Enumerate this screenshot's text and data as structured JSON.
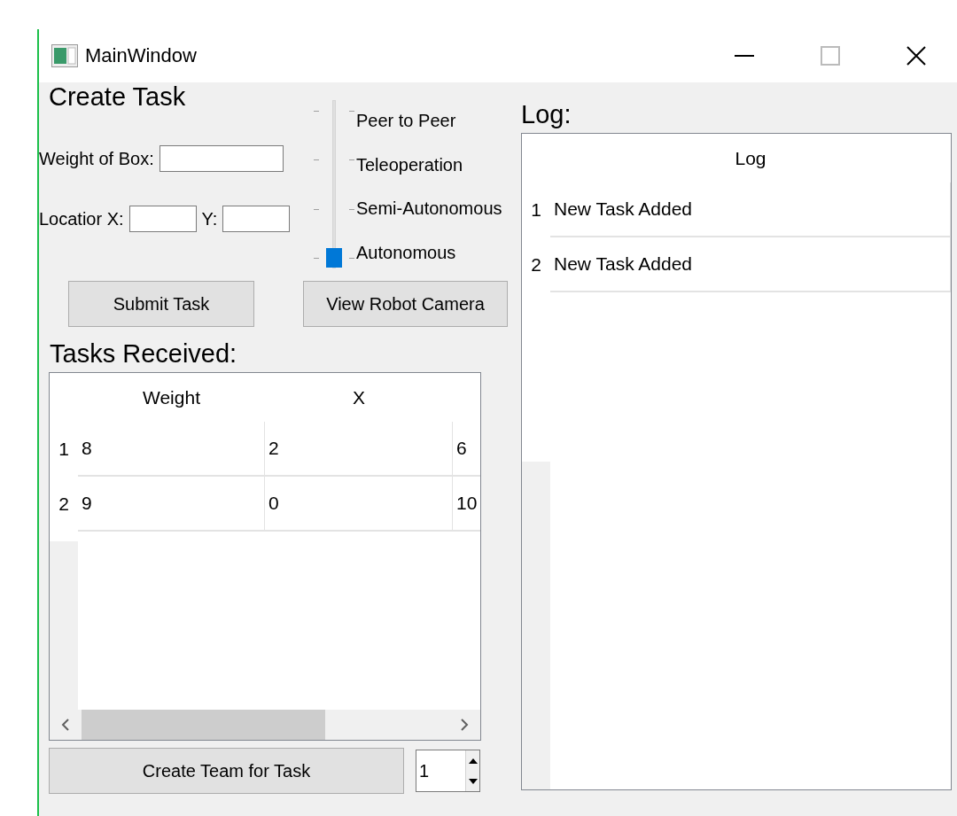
{
  "window": {
    "title": "MainWindow"
  },
  "create_task": {
    "heading": "Create Task",
    "weight_field": {
      "label": "Weight of Box:"
    },
    "location": {
      "x_label": "Locatior X:",
      "y_label": "Y:"
    },
    "mode_slider": {
      "level": 0,
      "labels": [
        "Peer to Peer",
        "Teleoperation",
        "Semi-Autonomous",
        "Autonomous"
      ]
    },
    "buttons": [
      "Submit Task",
      "View Robot Camera"
    ]
  },
  "tasks": {
    "heading": "Tasks Received:",
    "columns": [
      "Weight",
      "X"
    ],
    "rows": [
      {
        "number": "1",
        "cells": [
          "8",
          "2",
          "6"
        ]
      },
      {
        "number": "2",
        "cells": [
          "9",
          "0",
          "10"
        ]
      }
    ],
    "team_button": "Create Team for Task",
    "team_size": {
      "value": "1"
    }
  },
  "log": {
    "heading": "Log:",
    "column": "Log",
    "rows": [
      {
        "number": "1",
        "text": "New Task Added"
      },
      {
        "number": "2",
        "text": "New Task Added"
      }
    ]
  }
}
